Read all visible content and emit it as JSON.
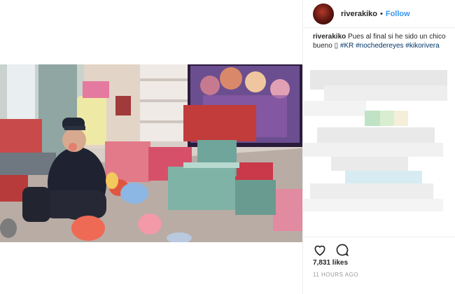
{
  "post": {
    "username": "riverakiko",
    "separator": "•",
    "follow_label": "Follow",
    "caption_user": "riverakiko",
    "caption_text": "Pues al final si he sido un chico bueno",
    "caption_emoji": "▯",
    "hashtags": [
      "#KR",
      "#nochedereyes",
      "#kikorivera"
    ],
    "likes": "7,831 likes",
    "timestamp": "11 HOURS AGO"
  },
  "icons": {
    "like": "heart-icon",
    "comment": "comment-icon"
  },
  "colors": {
    "link": "#3897f0",
    "hashtag": "#003569",
    "muted": "#999999"
  }
}
